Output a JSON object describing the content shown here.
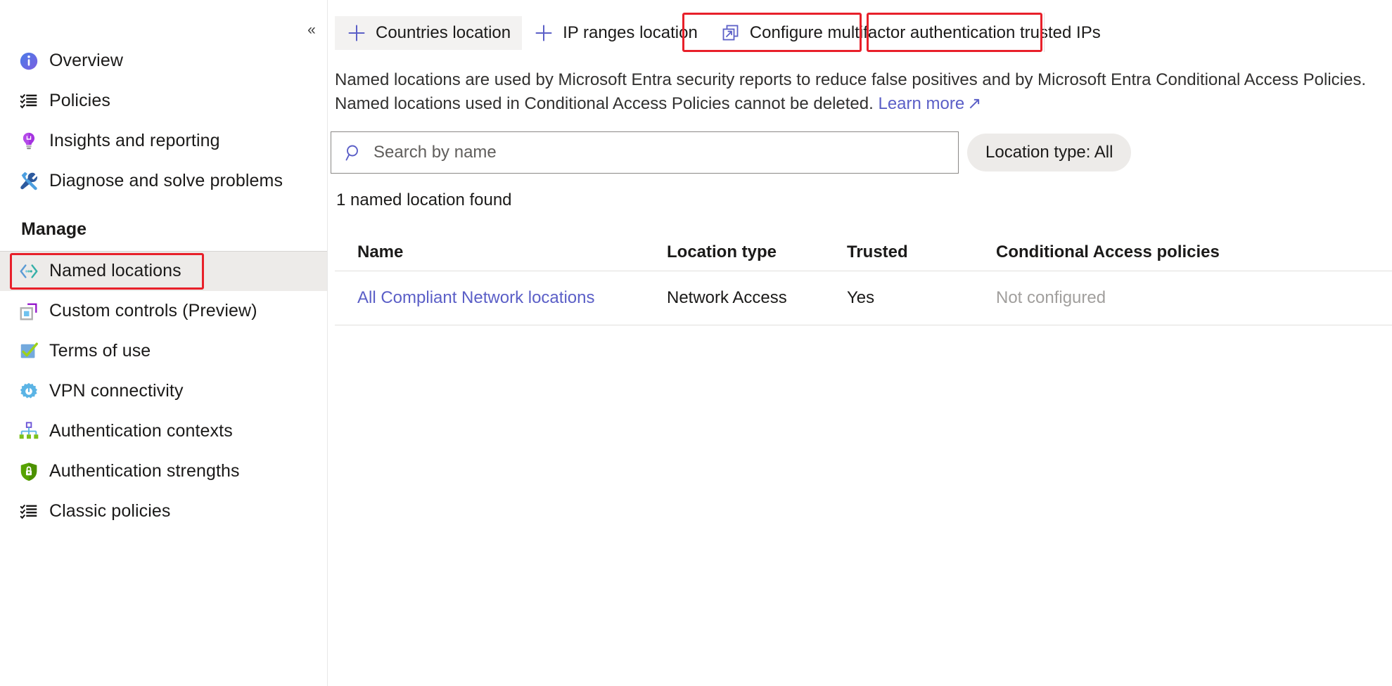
{
  "sidebar": {
    "collapse_icon": "double-chevron-left-icon",
    "items": [
      {
        "label": "Overview",
        "icon": "info-icon"
      },
      {
        "label": "Policies",
        "icon": "checklist-icon"
      },
      {
        "label": "Insights and reporting",
        "icon": "lightbulb-icon"
      },
      {
        "label": "Diagnose and solve problems",
        "icon": "tools-icon"
      }
    ],
    "section_label": "Manage",
    "manage_items": [
      {
        "label": "Named locations",
        "icon": "location-arrows-icon",
        "selected": true
      },
      {
        "label": "Custom controls (Preview)",
        "icon": "custom-controls-icon",
        "selected": false
      },
      {
        "label": "Terms of use",
        "icon": "checkbox-check-icon",
        "selected": false
      },
      {
        "label": "VPN connectivity",
        "icon": "gear-icon",
        "selected": false
      },
      {
        "label": "Authentication contexts",
        "icon": "hierarchy-icon",
        "selected": false
      },
      {
        "label": "Authentication strengths",
        "icon": "shield-lock-icon",
        "selected": false
      },
      {
        "label": "Classic policies",
        "icon": "checklist-icon",
        "selected": false
      }
    ]
  },
  "toolbar": {
    "countries_label": "Countries location",
    "countries_icon": "plus-icon",
    "ip_ranges_label": "IP ranges location",
    "ip_ranges_icon": "plus-icon",
    "configure_mfa_label": "Configure multifactor authentication trusted IPs",
    "configure_mfa_icon": "external-link-icon"
  },
  "description": {
    "text_before_link": "Named locations are used by Microsoft Entra security reports to reduce false positives and by Microsoft Entra Conditional Access Policies. Named locations used in Conditional Access Policies cannot be deleted.",
    "link_label": "Learn more",
    "link_icon": "external-link-icon"
  },
  "search": {
    "placeholder": "Search by name",
    "value": "",
    "icon": "search-icon"
  },
  "filters": {
    "location_type_label": "Location type: All"
  },
  "results": {
    "count_label": "1 named location found"
  },
  "table": {
    "columns": [
      "Name",
      "Location type",
      "Trusted",
      "Conditional Access policies"
    ],
    "rows": [
      {
        "name": "All Compliant Network locations",
        "location_type": "Network Access",
        "trusted": "Yes",
        "conditional_access": "Not configured"
      }
    ]
  },
  "colors": {
    "accent": "#5b5fc7",
    "highlight": "#e8202a",
    "selected_bg": "#edebe9"
  }
}
